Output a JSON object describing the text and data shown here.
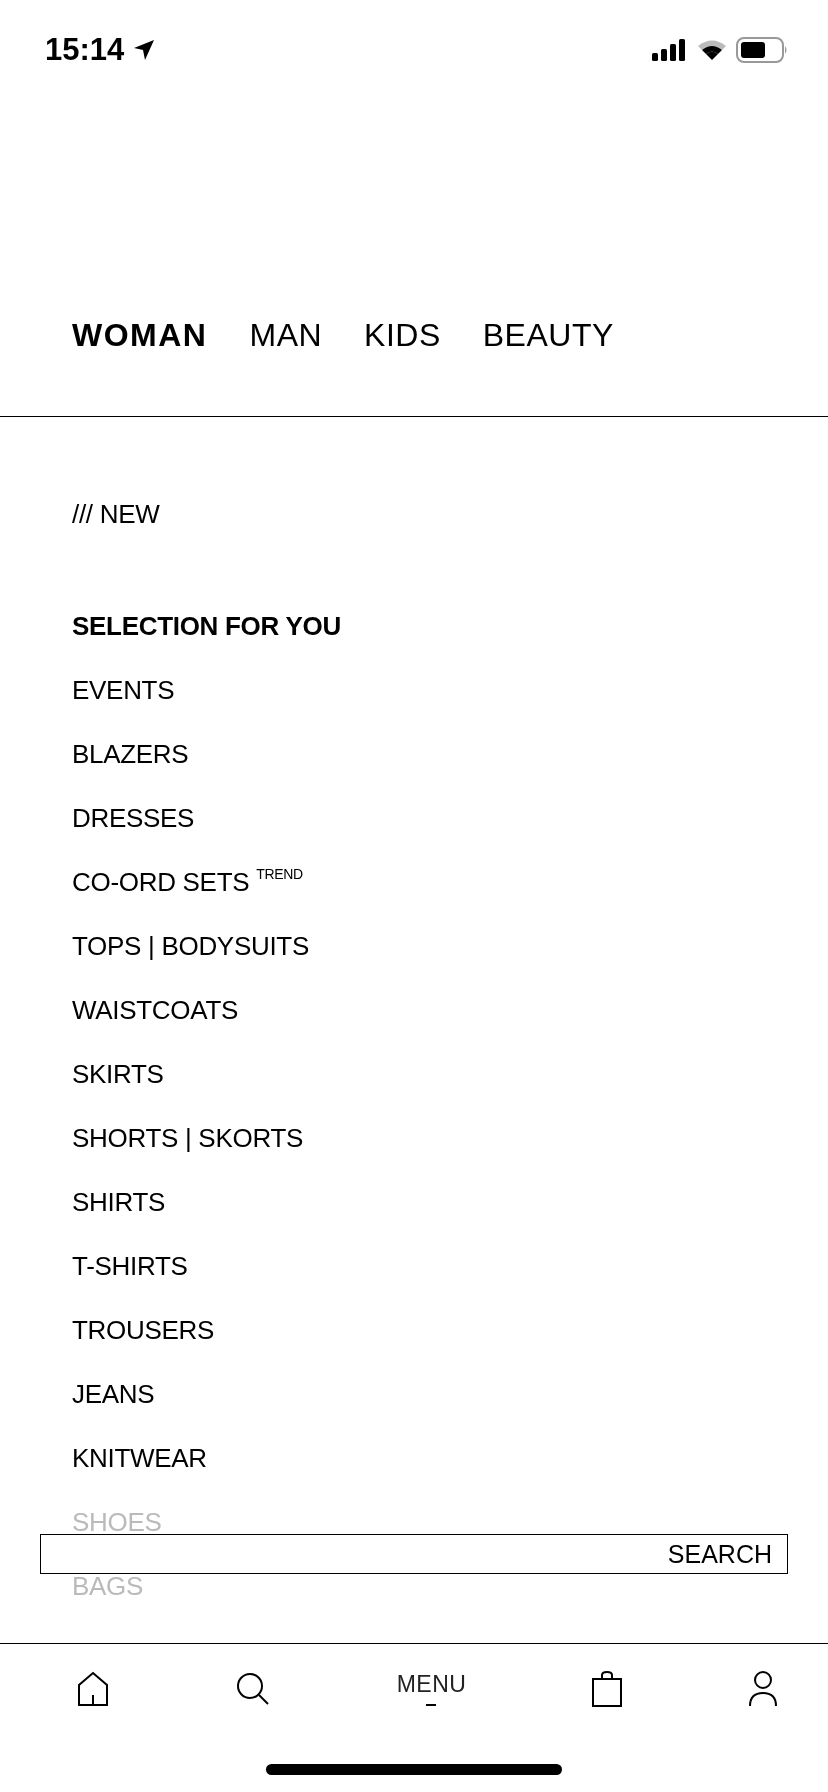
{
  "status_bar": {
    "time": "15:14"
  },
  "tabs": [
    {
      "label": "WOMAN",
      "selected": true
    },
    {
      "label": "MAN",
      "selected": false
    },
    {
      "label": "KIDS",
      "selected": false
    },
    {
      "label": "BEAUTY",
      "selected": false
    }
  ],
  "menu": [
    {
      "label": "/// NEW",
      "kind": "top",
      "faded": false
    },
    {
      "label": "SELECTION FOR YOU",
      "kind": "heading",
      "faded": false
    },
    {
      "label": "EVENTS",
      "kind": "item",
      "faded": false
    },
    {
      "label": "BLAZERS",
      "kind": "item",
      "faded": false
    },
    {
      "label": "DRESSES",
      "kind": "item",
      "faded": false
    },
    {
      "label": "CO-ORD SETS $^{TREND}$",
      "kind": "item",
      "faded": false
    },
    {
      "label": "TOPS | BODYSUITS",
      "kind": "item",
      "faded": false
    },
    {
      "label": "WAISTCOATS",
      "kind": "item",
      "faded": false
    },
    {
      "label": "SKIRTS",
      "kind": "item",
      "faded": false
    },
    {
      "label": "SHORTS | SKORTS",
      "kind": "item",
      "faded": false
    },
    {
      "label": "SHIRTS",
      "kind": "item",
      "faded": false
    },
    {
      "label": "T-SHIRTS",
      "kind": "item",
      "faded": false
    },
    {
      "label": "TROUSERS",
      "kind": "item",
      "faded": false
    },
    {
      "label": "JEANS",
      "kind": "item",
      "faded": false
    },
    {
      "label": "KNITWEAR",
      "kind": "item",
      "faded": false
    },
    {
      "label": "SHOES",
      "kind": "item",
      "faded": true
    },
    {
      "label": "BAGS",
      "kind": "item",
      "faded": true
    }
  ],
  "search": {
    "label": "SEARCH"
  },
  "bottom_nav": [
    {
      "kind": "home",
      "selected": false
    },
    {
      "kind": "search",
      "selected": false
    },
    {
      "kind": "menu",
      "label": "MENU",
      "selected": true
    },
    {
      "kind": "bag",
      "selected": false
    },
    {
      "kind": "account",
      "selected": false
    }
  ]
}
